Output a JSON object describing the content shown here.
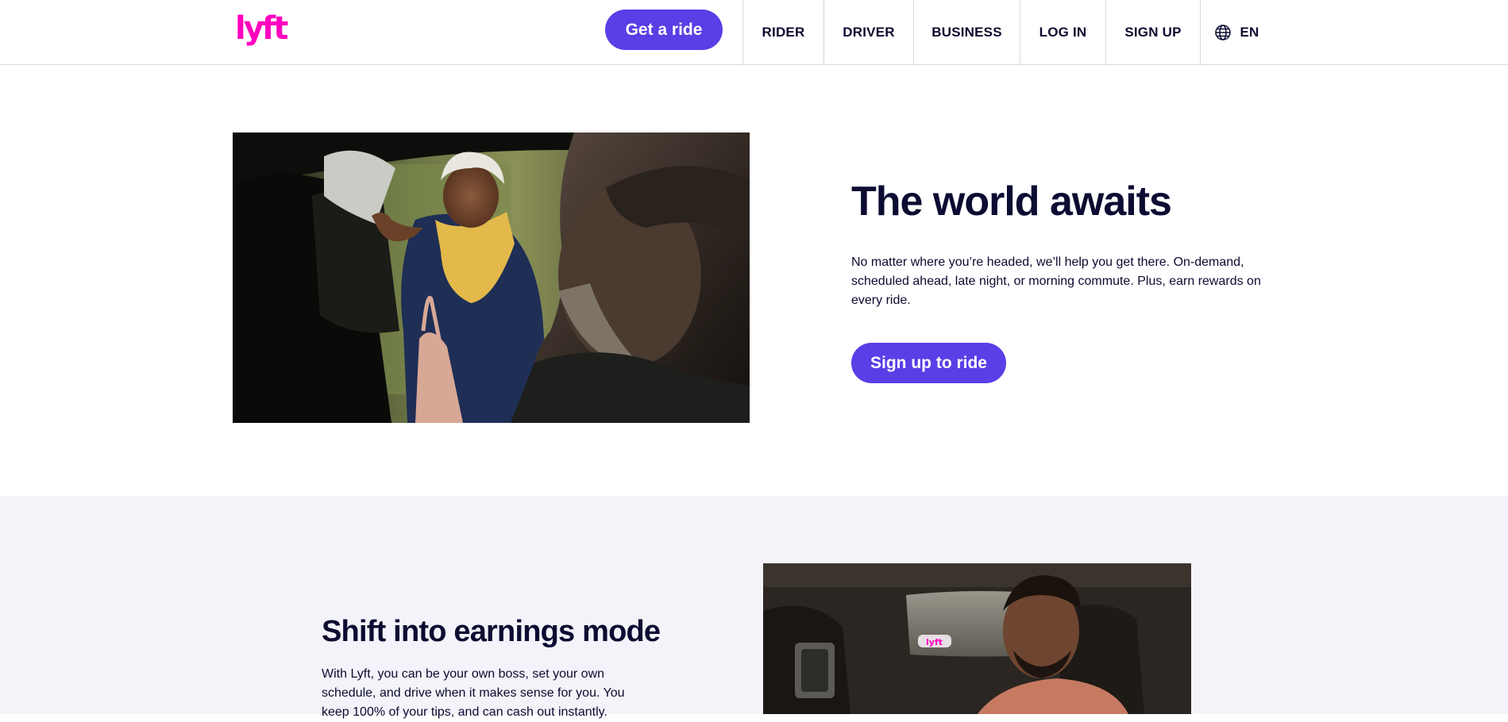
{
  "header": {
    "logo_text": "lyft",
    "get_ride_label": "Get a ride",
    "nav": {
      "rider": "RIDER",
      "driver": "DRIVER",
      "business": "BUSINESS",
      "login": "LOG IN",
      "signup": "SIGN UP",
      "language": "EN"
    }
  },
  "hero": {
    "title": "The world awaits",
    "text": "No matter where you’re headed, we’ll help you get there. On-demand, scheduled ahead, late night, or morning commute. Plus, earn rewards on every ride.",
    "cta_label": "Sign up to ride"
  },
  "earnings": {
    "title": "Shift into earnings mode",
    "text": "With Lyft, you can be your own boss, set your own schedule, and drive when it makes sense for you. You keep 100% of your tips, and can cash out instantly."
  },
  "colors": {
    "brand_pink": "#ff00bf",
    "brand_purple": "#5a3ee6",
    "text_dark": "#0c0b31",
    "section_bg": "#f3f3f9"
  },
  "icons": {
    "language": "globe-icon"
  }
}
